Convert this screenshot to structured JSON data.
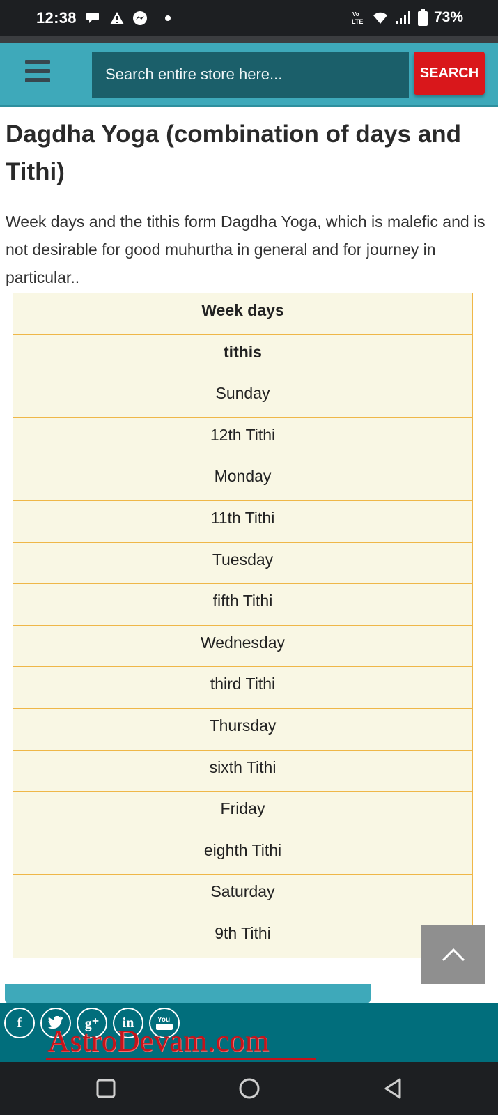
{
  "status_bar": {
    "time": "12:38",
    "battery": "73%"
  },
  "header": {
    "search_placeholder": "Search entire store here...",
    "search_button": "SEARCH"
  },
  "article": {
    "title": "Dagdha Yoga (combination of days and Tithi)",
    "intro": "Week days and the tithis form Dagdha Yoga, which is malefic and is not desirable for good muhurtha in general and for journey in particular..",
    "table": {
      "headers": [
        "Week days",
        "tithis"
      ],
      "rows": [
        "Sunday",
        "12th Tithi",
        "Monday",
        "11th Tithi",
        "Tuesday",
        "fifth Tithi",
        "Wednesday",
        "third Tithi",
        "Thursday",
        "sixth Tithi",
        "Friday",
        "eighth Tithi",
        "Saturday",
        "9th Tithi"
      ]
    }
  },
  "footer": {
    "brand": "AstroDevam.com",
    "social_icons": [
      "facebook-icon",
      "twitter-icon",
      "google-plus-icon",
      "linkedin-icon",
      "youtube-icon"
    ]
  },
  "colors": {
    "header_bg": "#3ea9ba",
    "search_button": "#d9171b",
    "table_bg": "#f9f7e4",
    "table_border": "#efb748",
    "footer_bg": "#016e7c"
  }
}
